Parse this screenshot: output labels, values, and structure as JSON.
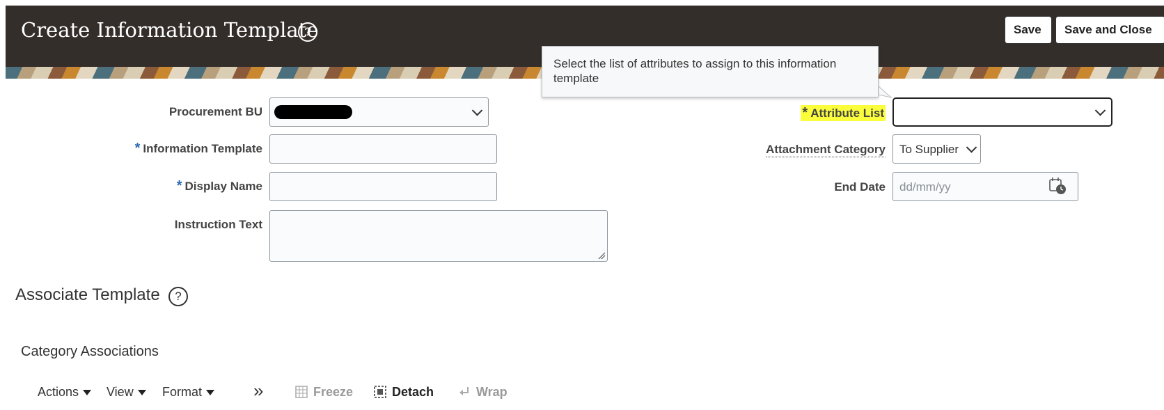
{
  "header": {
    "title": "Create Information Template",
    "help_glyph": "?",
    "save_label": "Save",
    "save_close_label": "Save and Close"
  },
  "tooltip": {
    "text": "Select the list of attributes to assign to this information template"
  },
  "form": {
    "procurement_bu": {
      "label": "Procurement BU",
      "value": ""
    },
    "information_template": {
      "label": "Information Template",
      "value": ""
    },
    "display_name": {
      "label": "Display Name",
      "value": ""
    },
    "instruction_text": {
      "label": "Instruction Text",
      "value": ""
    },
    "attribute_list": {
      "label": "Attribute List",
      "value": ""
    },
    "attachment_category": {
      "label": "Attachment Category",
      "value": "To Supplier"
    },
    "end_date": {
      "label": "End Date",
      "placeholder": "dd/mm/yy"
    },
    "required_mark": "*"
  },
  "associate": {
    "title": "Associate Template",
    "help_glyph": "?",
    "subtitle": "Category Associations"
  },
  "toolbar": {
    "actions": "Actions",
    "view": "View",
    "format": "Format",
    "more": "»",
    "freeze": "Freeze",
    "detach": "Detach",
    "wrap": "Wrap"
  },
  "icons": [
    "help-icon",
    "chevron-down-icon",
    "calendar-icon",
    "resize-grip-icon",
    "freeze-icon",
    "detach-icon",
    "wrap-icon"
  ],
  "colors": {
    "header_bg": "#342e2b",
    "required": "#2a6ab1",
    "highlight": "#fbff3b"
  }
}
